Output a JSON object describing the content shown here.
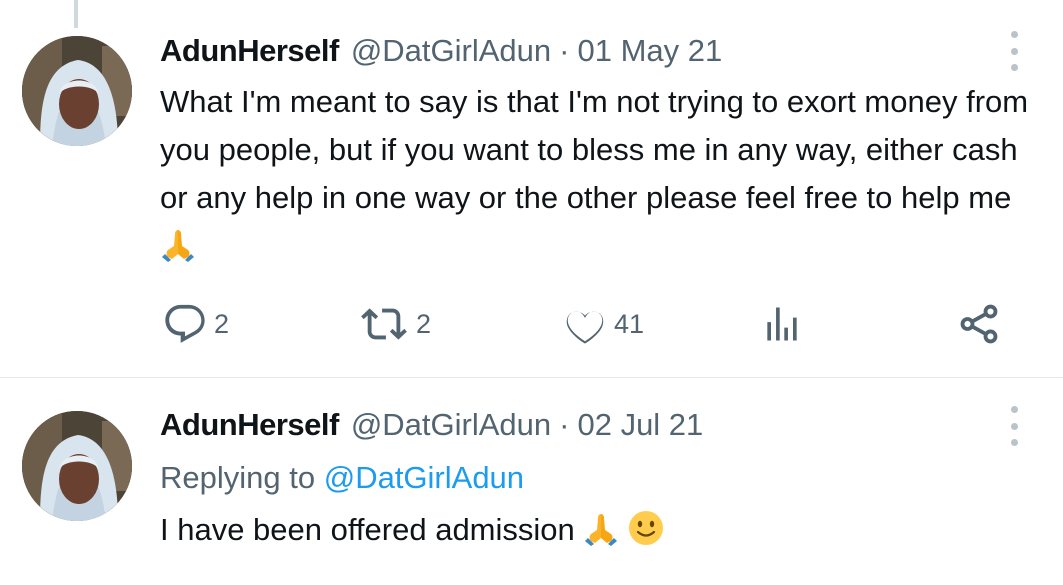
{
  "tweets": [
    {
      "display_name": "AdunHerself",
      "handle": "@DatGirlAdun",
      "separator": "·",
      "date": "01 May 21",
      "text": "What I'm meant to say is that I'm not trying to exort money from you people, but if you want to bless me in any way, either cash or any help in one way or the other please feel free to help me",
      "trailing_emoji": "folded-hands",
      "actions": {
        "replies": "2",
        "retweets": "2",
        "likes": "41"
      }
    },
    {
      "display_name": "AdunHerself",
      "handle": "@DatGirlAdun",
      "separator": "·",
      "date": "02 Jul 21",
      "replying_prefix": "Replying to",
      "replying_to": "@DatGirlAdun",
      "text": "I have been offered admission",
      "trailing_emoji": [
        "folded-hands",
        "slightly-smiling-face"
      ]
    }
  ],
  "icons": {
    "reply": "reply-icon",
    "retweet": "retweet-icon",
    "like": "heart-icon",
    "views": "views-icon",
    "share": "share-icon",
    "more": "more-vertical-icon"
  },
  "colors": {
    "text": "#0f1419",
    "secondary": "#536471",
    "link": "#1d9bf0",
    "divider": "#e4e9ec"
  }
}
